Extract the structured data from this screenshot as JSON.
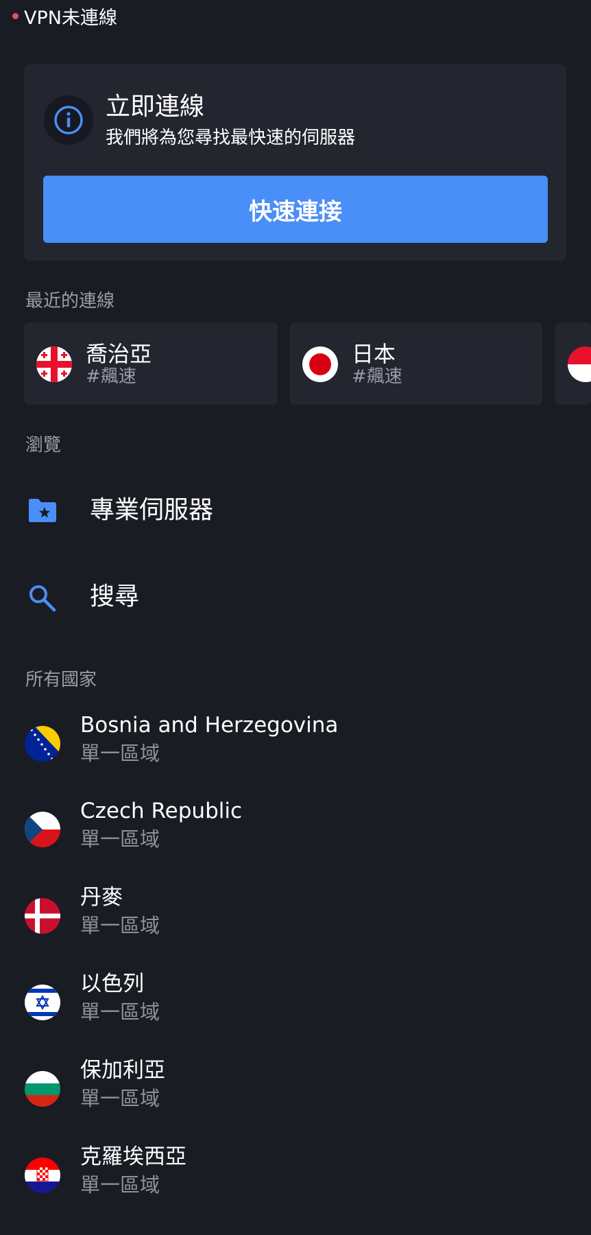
{
  "status": {
    "text": "VPN未連線",
    "dot_color": "#e2535e"
  },
  "connect_card": {
    "title": "立即連線",
    "subtitle": "我們將為您尋找最快速的伺服器",
    "button_label": "快速連接",
    "icon": "info-icon",
    "accent": "#4a8ef7"
  },
  "recent": {
    "label": "最近的連線",
    "items": [
      {
        "name": "喬治亞",
        "tag": "#飆速",
        "flag": "georgia-flag-icon"
      },
      {
        "name": "日本",
        "tag": "#飆速",
        "flag": "japan-flag-icon"
      },
      {
        "name": "",
        "tag": "",
        "flag": "red-white-flag-icon"
      }
    ]
  },
  "browse": {
    "label": "瀏覽",
    "items": [
      {
        "label": "專業伺服器",
        "icon": "folder-star-icon"
      },
      {
        "label": "搜尋",
        "icon": "search-icon"
      }
    ]
  },
  "countries": {
    "label": "所有國家",
    "items": [
      {
        "name": "Bosnia and Herzegovina",
        "sub": "單一區域",
        "flag": "bosnia-flag-icon"
      },
      {
        "name": "Czech Republic",
        "sub": "單一區域",
        "flag": "czech-flag-icon"
      },
      {
        "name": "丹麥",
        "sub": "單一區域",
        "flag": "denmark-flag-icon"
      },
      {
        "name": "以色列",
        "sub": "單一區域",
        "flag": "israel-flag-icon"
      },
      {
        "name": "保加利亞",
        "sub": "單一區域",
        "flag": "bulgaria-flag-icon"
      },
      {
        "name": "克羅埃西亞",
        "sub": "單一區域",
        "flag": "croatia-flag-icon"
      }
    ]
  }
}
